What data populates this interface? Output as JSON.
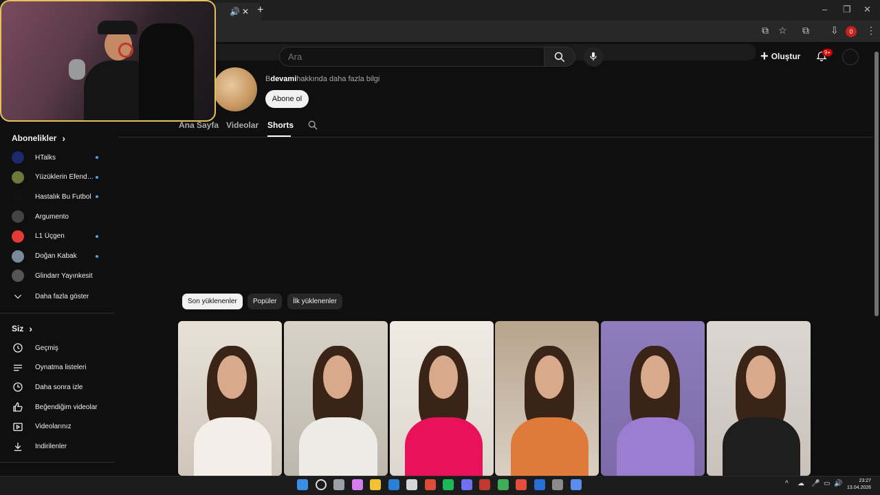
{
  "search": {
    "placeholder": "Ara"
  },
  "header": {
    "create_label": "Oluştur",
    "notifications_badge": "9+"
  },
  "browser": {
    "profile_badge": "0"
  },
  "channel": {
    "more_info_prefix": "B",
    "more_info_bold": "devami",
    "more_info_suffix": "hakkında daha fazla bilgi",
    "subscribe_label": "Abone ol",
    "tabs": [
      {
        "label": "Ana Sayfa",
        "active": false
      },
      {
        "label": "Videolar",
        "active": false
      },
      {
        "label": "Shorts",
        "active": true
      }
    ]
  },
  "chips": [
    {
      "label": "Son yüklenenler",
      "active": true
    },
    {
      "label": "Popüler",
      "active": false
    },
    {
      "label": "İlk yüklenenler",
      "active": false
    }
  ],
  "sidebar": {
    "subscriptions_title": "Abonelikler",
    "subscriptions": [
      {
        "label": "HTalks",
        "new": true,
        "color": "#1a2a6c"
      },
      {
        "label": "Yüzüklerin Efend…",
        "new": true,
        "color": "#6b7a3a"
      },
      {
        "label": "Hastalık Bu Futbol",
        "new": true,
        "color": "#111111"
      },
      {
        "label": "Argumento",
        "new": false,
        "color": "#444444"
      },
      {
        "label": "L1 Üçgen",
        "new": true,
        "color": "#e53935"
      },
      {
        "label": "Doğan Kabak",
        "new": true,
        "color": "#7a8a9a"
      },
      {
        "label": "Glindarr Yayınkesit",
        "new": false,
        "color": "#555555"
      }
    ],
    "show_more": "Daha fazla göster",
    "you_title": "Siz",
    "you_items": [
      {
        "label": "Geçmiş",
        "icon": "history-icon"
      },
      {
        "label": "Oynatma listeleri",
        "icon": "playlists-icon"
      },
      {
        "label": "Daha sonra izle",
        "icon": "watch-later-icon"
      },
      {
        "label": "Beğendiğim videolar",
        "icon": "like-icon"
      },
      {
        "label": "Videolarınız",
        "icon": "your-videos-icon"
      },
      {
        "label": "İndirilenler",
        "icon": "download-icon"
      }
    ]
  },
  "shorts": [
    {
      "bg": "#cfc6bb",
      "top": "#e7e1d6",
      "shirt": "#f3efe8"
    },
    {
      "bg": "#bdb7ad",
      "top": "#d8d2c6",
      "shirt": "#ecebe6"
    },
    {
      "bg": "#ddd7cf",
      "top": "#efeae3",
      "shirt": "#e8115a"
    },
    {
      "bg": "#d9cfc3",
      "top": "#b9a48d",
      "shirt": "#e07a3a"
    },
    {
      "bg": "#7d6aa8",
      "top": "#8e7cbc",
      "shirt": "#9b7ed2"
    },
    {
      "bg": "#c9c2bc",
      "top": "#dcd6d0",
      "shirt": "#1e1e1e"
    }
  ],
  "taskbar": {
    "time": "23:27",
    "date": "13.04.2026"
  }
}
